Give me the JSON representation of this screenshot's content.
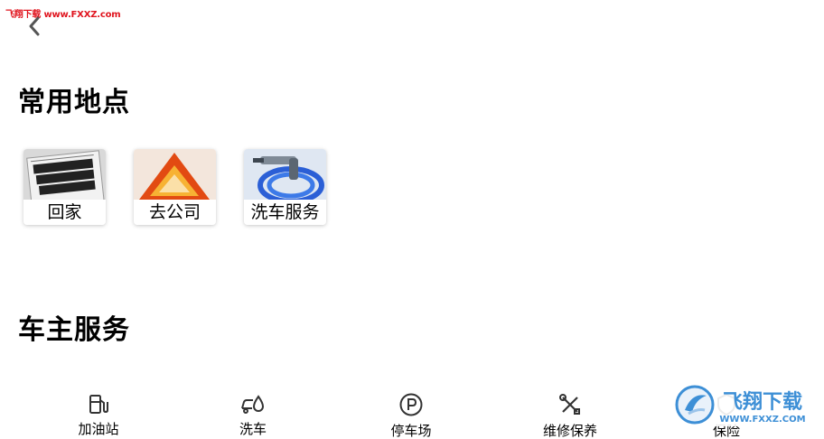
{
  "watermark": {
    "text": "飞翔下载 www.FXXZ.com"
  },
  "header": {
    "back_icon": "chevron-left-icon"
  },
  "common_places": {
    "title": "常用地点",
    "items": [
      {
        "label": "回家",
        "image": "newspaper-image"
      },
      {
        "label": "去公司",
        "image": "warning-triangle-image"
      },
      {
        "label": "洗车服务",
        "image": "hose-nozzle-image"
      }
    ]
  },
  "owner_services": {
    "title": "车主服务",
    "items": [
      {
        "label": "加油站",
        "icon": "fuel-pump-icon"
      },
      {
        "label": "洗车",
        "icon": "car-wash-icon"
      },
      {
        "label": "停车场",
        "icon": "parking-icon"
      },
      {
        "label": "维修保养",
        "icon": "wrench-screwdriver-icon"
      },
      {
        "label": "保险",
        "icon": "insurance-icon"
      }
    ]
  },
  "logo_watermark": {
    "brand": "飞翔下载",
    "url": "WWW.FXXZ.COM"
  },
  "colors": {
    "watermark_red": "#e0141e",
    "logo_blue": "#3d8fd6"
  }
}
